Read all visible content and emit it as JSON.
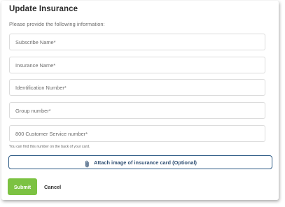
{
  "header": {
    "title": "Update Insurance",
    "subtitle": "Please provide the following information:"
  },
  "form": {
    "subscriber_name_placeholder": "Subscribe Name*",
    "insurance_name_placeholder": "Insurance Name*",
    "identification_number_placeholder": "Identification Number*",
    "group_number_placeholder": "Group number*",
    "customer_service_placeholder": "800 Customer Service number*",
    "customer_service_hint": "You can find this number on the back of your card.",
    "attach_icon": "paperclip-icon",
    "attach_label": "Attach image of insurance card (Optional)"
  },
  "actions": {
    "submit_label": "Submit",
    "cancel_label": "Cancel"
  },
  "colors": {
    "submit_green": "#7cc242",
    "attach_border_blue": "#2f5c86"
  }
}
